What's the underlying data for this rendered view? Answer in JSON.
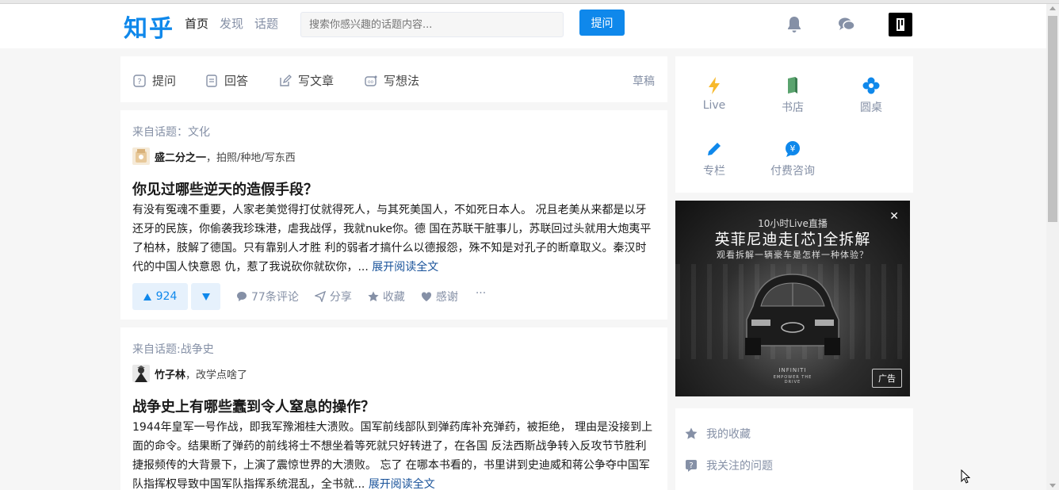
{
  "brand": {
    "logo": "知乎",
    "color": "#0f88eb"
  },
  "nav": {
    "items": [
      "首页",
      "发现",
      "话题"
    ]
  },
  "search": {
    "placeholder": "搜索你感兴趣的话题内容..."
  },
  "header": {
    "ask_button": "提问"
  },
  "actions": {
    "items": [
      "提问",
      "回答",
      "写文章",
      "写想法"
    ],
    "draft": "草稿"
  },
  "feed": [
    {
      "topic": "来自话题：文化",
      "author": "盛二分之一",
      "bio": "，拍照/种地/写东西",
      "title": "你见过哪些逆天的造假手段？",
      "excerpt": "有没有冤魂不重要，人家老美觉得打仗就得死人，与其死美国人，不如死日本人。 况且老美从来都是以牙还牙的民族，你偷袭我珍珠港，虐我战俘，我就nuke你。德 国在苏联干脏事儿，苏联回过头就用大炮夷平了柏林，肢解了德国。只有靠别人才胜 利的弱者才搞什么以德报怨，殊不知是对孔子的断章取义。秦汉时代的中国人快意恩 仇，惹了我说砍你就砍你，... ",
      "more": "展开阅读全文",
      "votes": "924",
      "comments": "77条评论",
      "share": "分享",
      "collect": "收藏",
      "thanks": "感谢",
      "dots": "···"
    },
    {
      "topic": "来自话题:战争史",
      "author": "竹子林",
      "bio": "，改学点啥了",
      "title": "战争史上有哪些蠢到令人窒息的操作？",
      "excerpt": "1944年皇军一号作战，即我军豫湘桂大溃败。国军前线部队到弹药库补充弹药，被拒绝， 理由是没接到上面的命令。结果断了弹药的前线将士不想坐着等死就只好转进了，在各国 反法西斯战争转入反攻节节胜利捷报频传的大背景下，上演了震惊世界的大溃败。 忘了 在哪本书看的，书里讲到史迪威和蒋公争夺中国军队指挥权导致中国军队指挥系统混乱，全书就... ",
      "more": "展开阅读全文"
    }
  ],
  "sidebar": {
    "grid": [
      "Live",
      "书店",
      "圆桌",
      "专栏",
      "付费咨询"
    ],
    "links": [
      "我的收藏",
      "我关注的问题"
    ]
  },
  "ad": {
    "line1": "10小时Live直播",
    "line2": "英菲尼迪走[芯]全拆解",
    "line3": "观看拆解一辆豪车是怎样一种体验？",
    "brand": "INFINITI",
    "slogan": "EMPOWER THE DRIVE",
    "tag": "广告",
    "close": "✕"
  }
}
